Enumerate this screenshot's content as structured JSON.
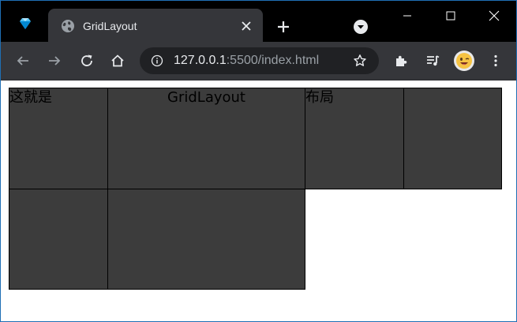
{
  "browser": {
    "tab": {
      "title": "GridLayout",
      "favicon": "globe-icon"
    },
    "pinned_tab_icon": "gem-icon",
    "omnibox": {
      "url_host": "127.0.0.1",
      "url_rest": ":5500/index.html"
    },
    "colors": {
      "tabstrip": "#000000",
      "toolbar": "#35363a",
      "omnibox": "#202124",
      "text": "#e8eaed",
      "muted_text": "#9aa0a6"
    }
  },
  "page": {
    "grid_background": "#3c3c3c",
    "grid_border": "#000000",
    "cells": [
      {
        "text": "这就是"
      },
      {
        "text": "GridLayout"
      },
      {
        "text": "布局"
      },
      {
        "text": ""
      },
      {
        "text": ""
      },
      {
        "text": ""
      }
    ]
  }
}
